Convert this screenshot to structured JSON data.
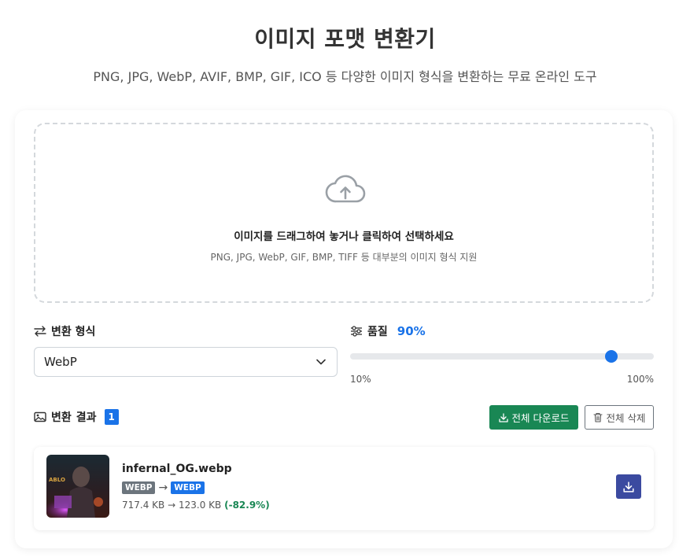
{
  "header": {
    "title": "이미지 포맷 변환기",
    "subtitle": "PNG, JPG, WebP, AVIF, BMP, GIF, ICO 등 다양한 이미지 형식을 변환하는 무료 온라인 도구"
  },
  "dropzone": {
    "icon": "cloud-upload-icon",
    "title": "이미지를 드래그하여 놓거나 클릭하여 선택하세요",
    "hint": "PNG, JPG, WebP, GIF, BMP, TIFF 등 대부분의 이미지 형식 지원"
  },
  "format": {
    "label": "변환 형식",
    "icon": "swap-arrows-icon",
    "selected": "WebP"
  },
  "quality": {
    "label": "품질",
    "icon": "sliders-icon",
    "value_text": "90%",
    "value": 0.9,
    "min_label": "10%",
    "max_label": "100%"
  },
  "results": {
    "label": "결과",
    "prefix": "변환",
    "icon": "images-icon",
    "count": "1",
    "download_all_label": "전체 다운로드",
    "delete_all_label": "전체 삭제"
  },
  "files": [
    {
      "name": "infernal_OG.webp",
      "from_format": "WEBP",
      "to_format": "WEBP",
      "arrow": "→",
      "original_size": "717.4 KB",
      "converted_size": "123.0 KB",
      "reduction": "(-82.9%)"
    }
  ],
  "colors": {
    "accent": "#1a73e8",
    "success": "#198754",
    "download_file_button": "#3b4aa0"
  }
}
